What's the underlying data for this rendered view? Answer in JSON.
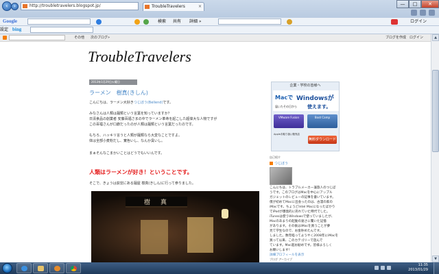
{
  "browser": {
    "address": "http://troubletravelers.blogspot.jp/",
    "tab_title": "TroubleTravelers",
    "caption": {
      "minimize": "—",
      "maximize": "□",
      "close": "✕"
    }
  },
  "google_toolbar": {
    "logo": "Google",
    "items": [
      "検索",
      "共有",
      "詳細 »"
    ],
    "right_label": "ログイン"
  },
  "bing_toolbar": {
    "logo": "bing",
    "items": [
      "その他",
      "次のブログ»"
    ],
    "right_label": "ログイン",
    "settings_label": "設定"
  },
  "blogger_bar": {
    "right_links": "ブログを作成　ログイン"
  },
  "blog": {
    "title": "TroubleTravelers",
    "date": "2013年1月29日火曜日",
    "post_title": "ラーメン　樹真(きしん)",
    "author_line_prefix": "こんにちは、ラーメン大好き",
    "author_link": "つじぼう(Bellend)",
    "author_line_suffix": "です。",
    "paragraphs": [
      "みなさんは人類は麺類という言葉を知っていますか？",
      "日清食品の創業者 安藤百福さまの中でラーメン革命を起こした超偉大な人物ですが",
      "この百福さんが口癖だったのが人類は麺類という言葉だったのです。",
      "",
      "もちろ、ハッキリ言うと人類が麺類なら大変なことですよ。",
      "体は全部小麦粉だし、實色いし、なんか臭いし。",
      "",
      "まぁそんなこまかいことはどうでもいいんです。"
    ],
    "headline": "人類はラーメンが好き！ということです。",
    "after_headline": "そこで、きょうは荻窪にある麺屋 樹真(きしん)に行って参りました。",
    "photo_sign": "樹　真"
  },
  "sidebar": {
    "ad": {
      "header": "企業・学校の皆様へ",
      "mac": "Macで",
      "windows": "Windowsが",
      "small": "届いたその日から",
      "big": "使えます。",
      "product_a": "VMware Fusion",
      "product_b": "Boot Camp",
      "note": "Appleお取り扱い販売店",
      "download": "無料ダウンロード"
    },
    "about_header": "自己紹介",
    "profile_name": "つじぼう",
    "profile_text": [
      "こんにちは、トラブルメーカー兼旅人のつじぼ",
      "うです。このブログはMacを中心にアップル",
      "ガジェットのレビューの記事を書いています。",
      "僕が初めてMacに出会ったのは、古漫の家の",
      "iMacです。ちょうどIntel Macになったばかり",
      "でiPodが爆発的に売れていた時代でした。",
      "iTunesは使うWindowsで使っていましたが、",
      "Macのあまりの起動の速さに驚いた記憶",
      "があります。その後はiMacを買うことが夢",
      "見て学生なので、お金貯めたんです。",
      "しました。数年経ってようやく2008年にiMacを",
      "買って以来、このカテゴリーで遊んで",
      "ています。Mac超お勧めです。皆様よろしく",
      "お願いします！"
    ],
    "profile_link": "詳細プロフィールを表示",
    "archive_header": "ブログ アーカイブ"
  },
  "taskbar": {
    "time": "11:35",
    "date": "2013/01/29"
  },
  "colors": {
    "link": "#4a89c8",
    "headline": "#e51f1f",
    "blogger_orange": "#f57d00"
  }
}
